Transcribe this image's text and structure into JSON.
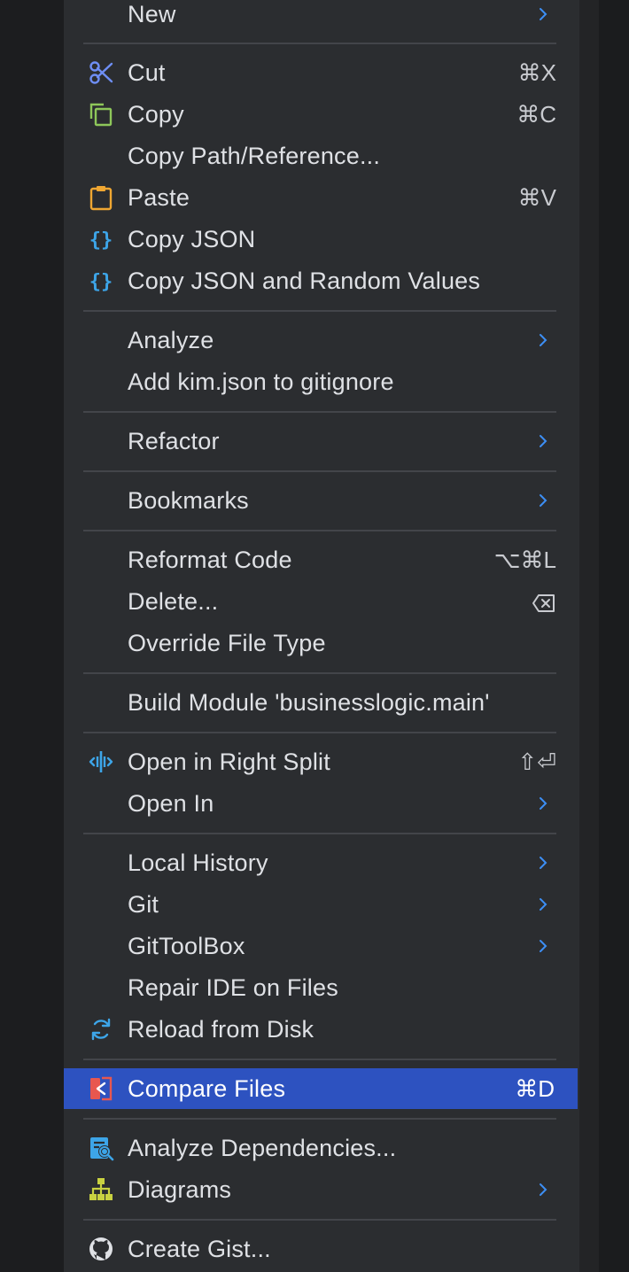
{
  "menu": {
    "new": {
      "label": "New"
    },
    "cut": {
      "label": "Cut",
      "shortcut": "⌘X",
      "icon": "scissors-icon"
    },
    "copy": {
      "label": "Copy",
      "shortcut": "⌘C",
      "icon": "copy-icon"
    },
    "copy_path": {
      "label": "Copy Path/Reference..."
    },
    "paste": {
      "label": "Paste",
      "shortcut": "⌘V",
      "icon": "clipboard-icon"
    },
    "copy_json": {
      "label": "Copy JSON",
      "icon": "json-braces-icon"
    },
    "copy_json_random": {
      "label": "Copy JSON and Random Values",
      "icon": "json-braces-icon"
    },
    "analyze": {
      "label": "Analyze"
    },
    "add_gitignore": {
      "label": "Add kim.json to gitignore"
    },
    "refactor": {
      "label": "Refactor"
    },
    "bookmarks": {
      "label": "Bookmarks"
    },
    "reformat": {
      "label": "Reformat Code",
      "shortcut": "⌥⌘L"
    },
    "delete": {
      "label": "Delete...",
      "icon": "delete-key-icon"
    },
    "override_type": {
      "label": "Override File Type"
    },
    "build_module": {
      "label": "Build Module 'businesslogic.main'"
    },
    "open_right_split": {
      "label": "Open in Right Split",
      "shortcut": "⇧⏎",
      "icon": "split-icon"
    },
    "open_in": {
      "label": "Open In"
    },
    "local_history": {
      "label": "Local History"
    },
    "git": {
      "label": "Git"
    },
    "gittoolbox": {
      "label": "GitToolBox"
    },
    "repair_ide": {
      "label": "Repair IDE on Files"
    },
    "reload_disk": {
      "label": "Reload from Disk",
      "icon": "refresh-icon"
    },
    "compare_files": {
      "label": "Compare Files",
      "shortcut": "⌘D",
      "icon": "compare-icon"
    },
    "analyze_deps": {
      "label": "Analyze Dependencies...",
      "icon": "dependencies-icon"
    },
    "diagrams": {
      "label": "Diagrams",
      "icon": "diagram-icon"
    },
    "create_gist": {
      "label": "Create Gist...",
      "icon": "github-icon"
    }
  },
  "colors": {
    "menu_bg": "#2b2d30",
    "selection": "#2d52c0",
    "separator": "#43454a",
    "text": "#dfe1e5",
    "chevron": "#3d8ff5"
  }
}
